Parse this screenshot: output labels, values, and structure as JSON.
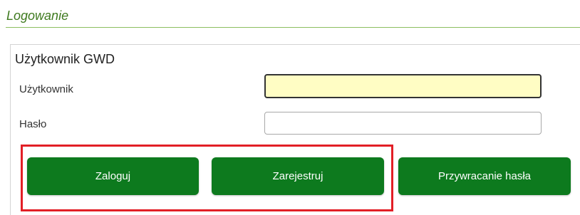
{
  "section": {
    "title": "Logowanie"
  },
  "panel": {
    "heading": "Użytkownik GWD",
    "username_label": "Użytkownik",
    "username_value": "",
    "password_label": "Hasło",
    "password_value": ""
  },
  "buttons": {
    "login": "Zaloguj",
    "register": "Zarejestruj",
    "recover": "Przywracanie hasła"
  },
  "colors": {
    "accent_green": "#0d7a1e",
    "title_green": "#3f7a1f",
    "highlight_red": "#e21f26",
    "focused_input_bg": "#fffdc4"
  }
}
